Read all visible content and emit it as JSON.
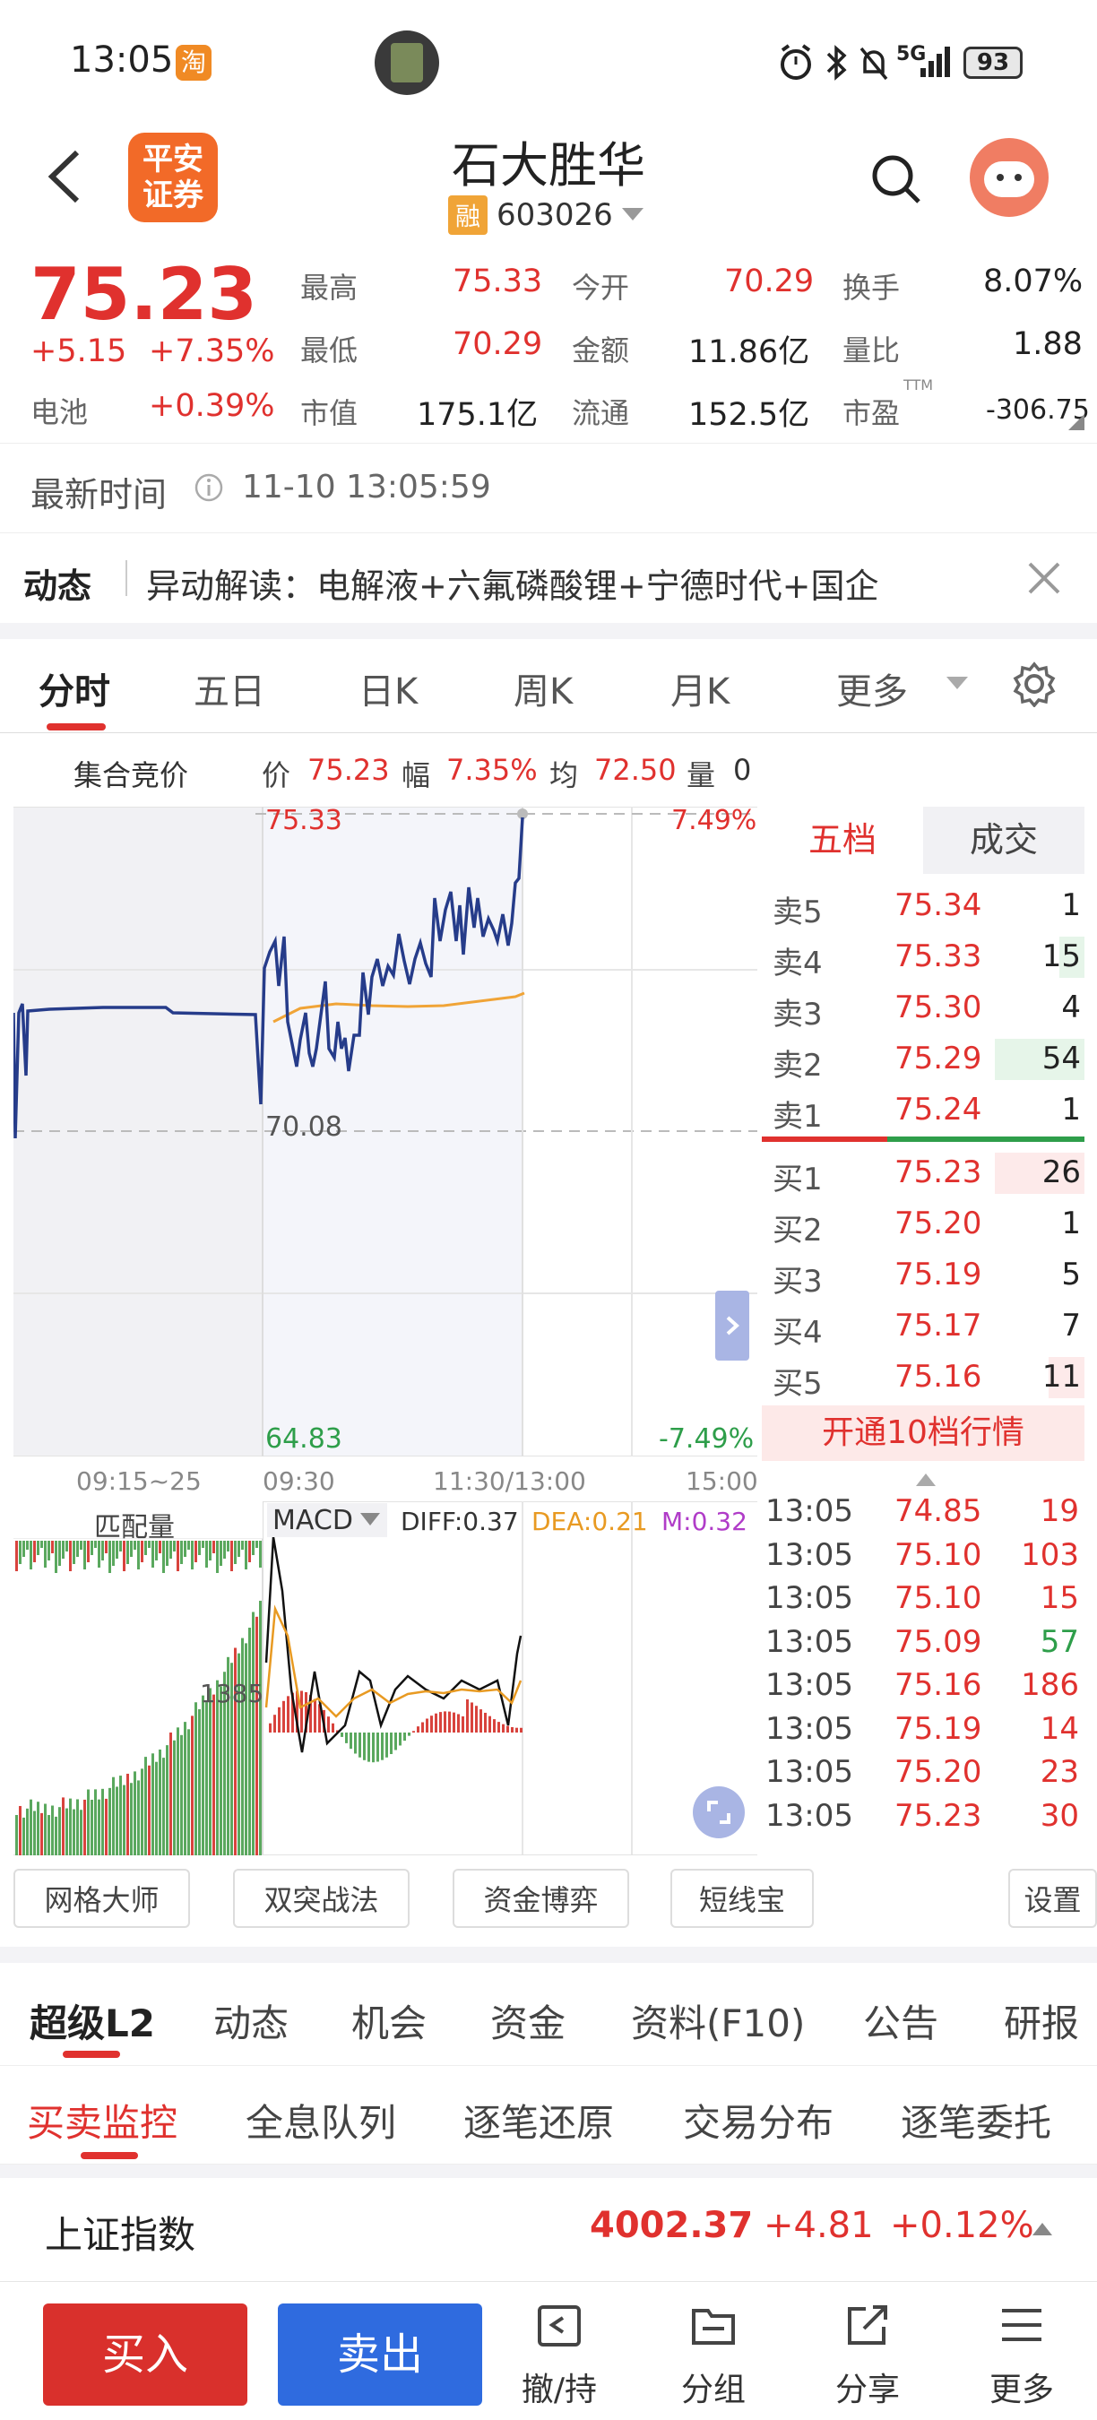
{
  "status": {
    "time": "13:05",
    "taobao_badge": "淘",
    "signal": "5G",
    "battery": "93"
  },
  "header": {
    "broker_logo": "平安\n证券",
    "stock_name": "石大胜华",
    "rong_badge": "融",
    "stock_code": "603026"
  },
  "quote": {
    "price": "75.23",
    "change": "+5.15",
    "change_pct": "+7.35%",
    "sector_label": "电池",
    "sector_pct": "+0.39%",
    "high_label": "最高",
    "high": "75.33",
    "open_label": "今开",
    "open": "70.29",
    "turnover_label": "换手",
    "turnover": "8.07%",
    "low_label": "最低",
    "low": "70.29",
    "amount_label": "金额",
    "amount": "11.86亿",
    "vol_ratio_label": "量比",
    "vol_ratio": "1.88",
    "mcap_label": "市值",
    "mcap": "175.1亿",
    "float_label": "流通",
    "float": "152.5亿",
    "pe_label": "市盈",
    "pe_sup": "TTM",
    "pe": "-306.75"
  },
  "update": {
    "label": "最新时间",
    "time": "11-10 13:05:59"
  },
  "news": {
    "label": "动态",
    "text": "异动解读：电解液+六氟磷酸锂+宁德时代+国企"
  },
  "tabs": [
    "分时",
    "五日",
    "日K",
    "周K",
    "月K",
    "更多"
  ],
  "infobar": {
    "auction": "集合竞价",
    "price_label": "价",
    "price": "75.23",
    "amp_label": "幅",
    "amp": "7.35%",
    "avg_label": "均",
    "avg": "72.50",
    "vol_label": "量",
    "vol": "0"
  },
  "chart_labels": {
    "top_price": "75.33",
    "top_pct": "7.49%",
    "mid_price": "70.08",
    "bot_price": "64.83",
    "bot_pct": "-7.49%"
  },
  "time_axis": [
    "09:15~25",
    "09:30",
    "11:30/13:00",
    "15:00"
  ],
  "macd": {
    "left_label": "匹配量",
    "indicator": "MACD",
    "diff": "DIFF:0.37",
    "dea": "DEA:0.21",
    "m": "M:0.32",
    "vol_label": "1385"
  },
  "orderbook": {
    "tab_active": "五档",
    "tab_other": "成交",
    "sells": [
      {
        "label": "卖5",
        "price": "75.34",
        "vol": "1",
        "bar": 0
      },
      {
        "label": "卖4",
        "price": "75.33",
        "vol": "15",
        "bar": 0.28
      },
      {
        "label": "卖3",
        "price": "75.30",
        "vol": "4",
        "bar": 0
      },
      {
        "label": "卖2",
        "price": "75.29",
        "vol": "54",
        "bar": 1.0
      },
      {
        "label": "卖1",
        "price": "75.24",
        "vol": "1",
        "bar": 0
      }
    ],
    "buys": [
      {
        "label": "买1",
        "price": "75.23",
        "vol": "26",
        "bar": 1.0
      },
      {
        "label": "买2",
        "price": "75.20",
        "vol": "1",
        "bar": 0
      },
      {
        "label": "买3",
        "price": "75.19",
        "vol": "5",
        "bar": 0
      },
      {
        "label": "买4",
        "price": "75.17",
        "vol": "7",
        "bar": 0
      },
      {
        "label": "买5",
        "price": "75.16",
        "vol": "11",
        "bar": 0.4
      }
    ],
    "upgrade": "开通10档行情"
  },
  "trades": [
    {
      "time": "13:05",
      "price": "74.85",
      "vol": "19",
      "dir": "r"
    },
    {
      "time": "13:05",
      "price": "75.10",
      "vol": "103",
      "dir": "r"
    },
    {
      "time": "13:05",
      "price": "75.10",
      "vol": "15",
      "dir": "r"
    },
    {
      "time": "13:05",
      "price": "75.09",
      "vol": "57",
      "dir": "g"
    },
    {
      "time": "13:05",
      "price": "75.16",
      "vol": "186",
      "dir": "r"
    },
    {
      "time": "13:05",
      "price": "75.19",
      "vol": "14",
      "dir": "r"
    },
    {
      "time": "13:05",
      "price": "75.20",
      "vol": "23",
      "dir": "r"
    },
    {
      "time": "13:05",
      "price": "75.23",
      "vol": "30",
      "dir": "r"
    }
  ],
  "tools": [
    "网格大师",
    "双突战法",
    "资金博弈",
    "短线宝",
    "设置"
  ],
  "l2tabs": [
    "超级L2",
    "动态",
    "机会",
    "资金",
    "资料(F10)",
    "公告",
    "研报"
  ],
  "subtabs": [
    "买卖监控",
    "全息队列",
    "逐笔还原",
    "交易分布",
    "逐笔委托"
  ],
  "index": {
    "name": "上证指数",
    "value": "4002.37",
    "change": "+4.81",
    "pct": "+0.12%"
  },
  "bottom": {
    "buy": "买入",
    "sell": "卖出",
    "cancel": "撤/持",
    "group": "分组",
    "share": "分享",
    "more": "更多"
  }
}
